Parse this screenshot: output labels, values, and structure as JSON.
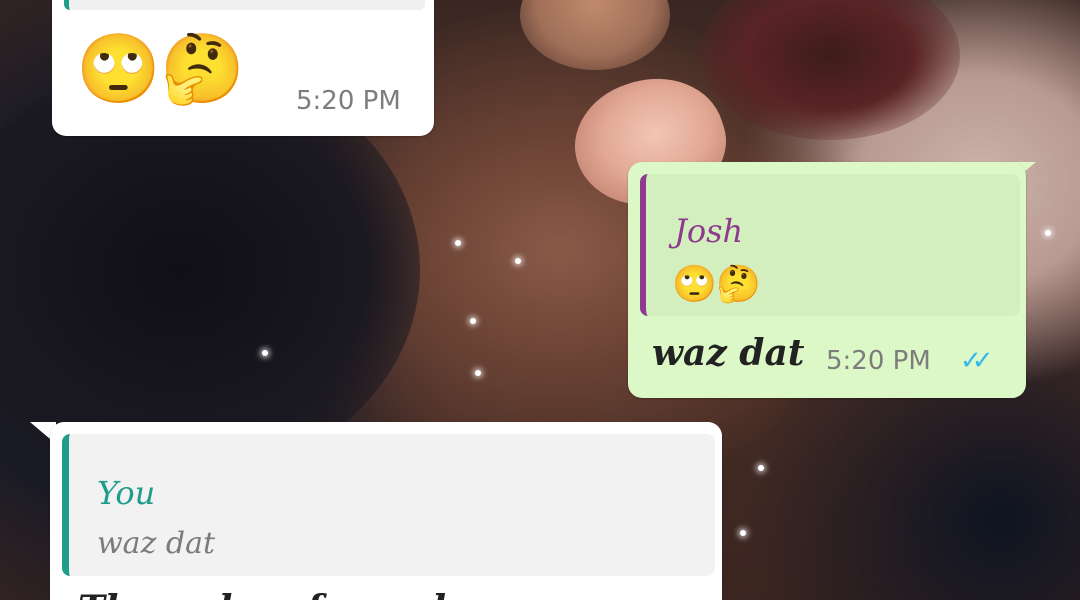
{
  "messages": [
    {
      "direction": "incoming",
      "emojis": [
        "🙄",
        "🤔"
      ],
      "time": "5:20 PM"
    },
    {
      "direction": "outgoing",
      "quoted": {
        "author": "Josh",
        "author_color": "#8e3a8e",
        "emojis": [
          "🙄",
          "🤔"
        ]
      },
      "text": "waz dat",
      "time": "5:20 PM",
      "status_icon": "double-check-read-icon",
      "status_color": "#34b7f1"
    },
    {
      "direction": "incoming",
      "quoted": {
        "author": "You",
        "author_color": "#1f9d8b",
        "text": "waz dat"
      },
      "text": "Th... ...k ... fe... ...h..."
    }
  ],
  "colors": {
    "incoming_bubble": "#ffffff",
    "outgoing_bubble": "#dcf8c6",
    "read_ticks": "#34b7f1"
  }
}
